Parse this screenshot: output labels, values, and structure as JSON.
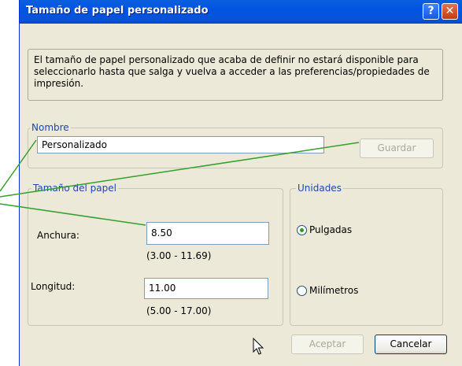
{
  "dialog": {
    "title": "Tamaño de papel personalizado",
    "help_button": "?",
    "close_button": "✕",
    "info_text": "El tamaño de papel personalizado que acaba de definir no estará disponible para seleccionarlo hasta que salga y vuelva a acceder a las preferencias/propiedades de impresión."
  },
  "name_group": {
    "legend": "Nombre",
    "value": "Personalizado",
    "save_label": "Guardar"
  },
  "paper_group": {
    "legend": "Tamaño del papel",
    "width_label": "Anchura:",
    "width_value": "8.50",
    "width_range": "(3.00 - 11.69)",
    "length_label": "Longitud:",
    "length_value": "11.00",
    "length_range": "(5.00 - 17.00)"
  },
  "units_group": {
    "legend": "Unidades",
    "options": [
      {
        "label": "Pulgadas",
        "selected": true
      },
      {
        "label": "Milímetros",
        "selected": false
      }
    ]
  },
  "footer": {
    "accept_label": "Aceptar",
    "cancel_label": "Cancelar"
  },
  "colors": {
    "titlebar": "#0054e3",
    "callout_line": "#33a02c",
    "legend_text": "#1a48b0"
  }
}
